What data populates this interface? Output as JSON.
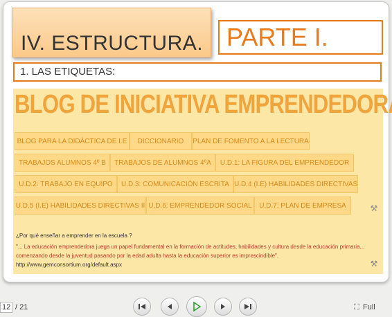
{
  "slide": {
    "title": "IV. ESTRUCTURA.",
    "part": "PARTE I.",
    "section": "1. LAS ETIQUETAS:"
  },
  "blog": {
    "title": "BLOG DE INICIATIVA EMPRENDEDORA",
    "tabs": [
      "BLOG PARA LA DIDÁCTICA DE I.E",
      "DICCIONARIO",
      "PLAN DE FOMENTO A LA LECTURA",
      "TRABAJOS ALUMNOS 4º B",
      "TRABAJOS DE ALUMNOS 4ºA",
      "U.D.1: LA FIGURA DEL EMPRENDEDOR",
      "U.D.2: TRABAJO EN EQUIPO",
      "U.D.3: COMUNICACIÓN ESCRITA",
      "U.D.4 (I.E) HABILIDADES DIRECTIVAS",
      "U.D.5 (I.E) HABILIDADES DIRECTIVAS II",
      "U.D.6: EMPRENDEDOR SOCIAL",
      "U.D.7: PLAN DE EMPRESA"
    ],
    "question": "¿Por qué enseñar a emprender en la escuela ?",
    "quote": "\"... La educación emprendedora juega un papel fundamental en la formación de actitudes, habilidades y cultura desde la educación primaria... comenzando desde la juventud pasando por la edad adulta hasta la educación superior es imprescindible\".",
    "url": "http://www.gemconsortium.org/default.aspx",
    "tool_icon": "wrench-screwdriver-icon"
  },
  "player": {
    "current_page": "12",
    "total": "/ 21",
    "full_label": "Full",
    "buttons": [
      "first-icon",
      "prev-icon",
      "play-icon",
      "next-icon",
      "last-icon"
    ]
  },
  "colors": {
    "accent": "#e87b1c",
    "title_box": "#fbc98a",
    "blog_bg": "#fde7a6",
    "tab_bg": "#ffd987",
    "tab_text": "#d98a1a",
    "blog_title": "#f0a43c",
    "quote": "#c0392b",
    "play_green": "#2fa02f"
  }
}
